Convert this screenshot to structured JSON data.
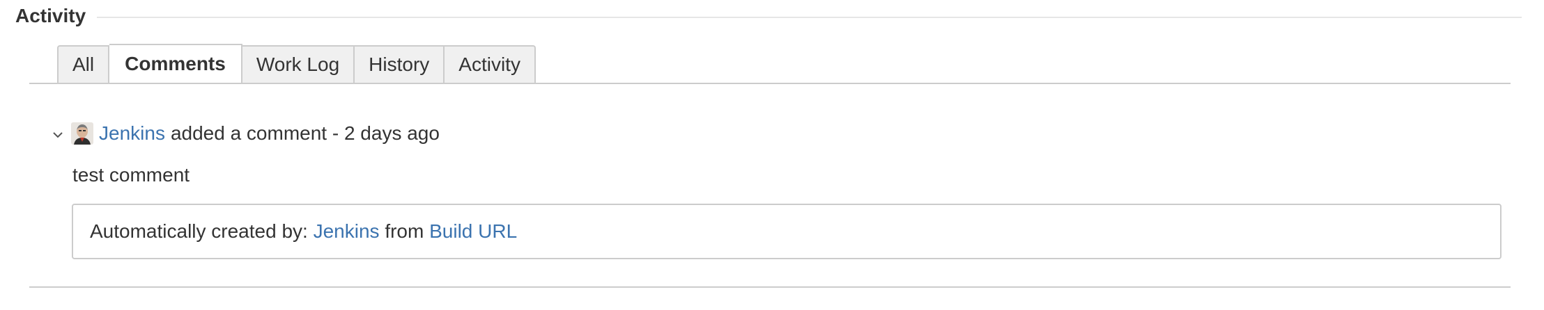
{
  "header": {
    "title": "Activity"
  },
  "tabs": [
    {
      "label": "All",
      "active": false
    },
    {
      "label": "Comments",
      "active": true
    },
    {
      "label": "Work Log",
      "active": false
    },
    {
      "label": "History",
      "active": false
    },
    {
      "label": "Activity",
      "active": false
    }
  ],
  "comment": {
    "author": "Jenkins",
    "action": "added a comment - 2 days ago",
    "body": "test comment",
    "auto_prefix": "Automatically created by:",
    "auto_author": "Jenkins",
    "auto_from": "from",
    "auto_link": "Build URL",
    "icons": {
      "collapse": "chevron-down-icon",
      "avatar": "user-avatar"
    }
  },
  "colors": {
    "link": "#3b73af",
    "text": "#333333",
    "border": "#cccccc",
    "tab_bg": "#f0f0f0"
  }
}
